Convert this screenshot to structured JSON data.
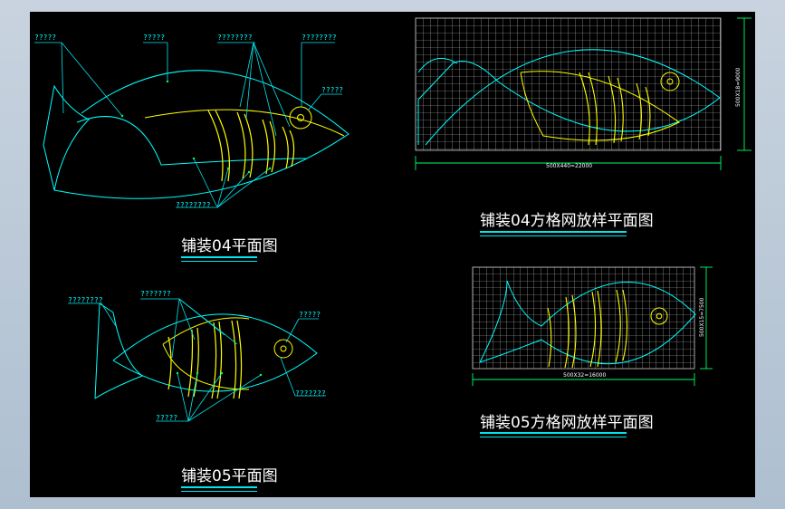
{
  "titles": {
    "plan04": "铺装04平面图",
    "plan05": "铺装05平面图",
    "grid04": "铺装04方格网放样平面图",
    "grid05": "铺装05方格网放样平面图"
  },
  "callouts_04": {
    "a": "?????",
    "b": "?????",
    "c": "????????",
    "d": "????????",
    "e": "?????",
    "f": "????????"
  },
  "callouts_05": {
    "a": "????????",
    "b": "???????",
    "c": "?????",
    "d": "???????",
    "e": "?????"
  },
  "dimensions": {
    "grid04_width": "500X440=22000",
    "grid04_height": "500X18=9000",
    "grid05_width": "500X32=16000",
    "grid05_height": "500X15=7500"
  },
  "colors": {
    "outline": "#00ffff",
    "stripes": "#ffff00",
    "grid": "#c0c0c0",
    "annotation": "#00e5ee",
    "pointer": "#00ff66",
    "title": "#ffffff"
  }
}
